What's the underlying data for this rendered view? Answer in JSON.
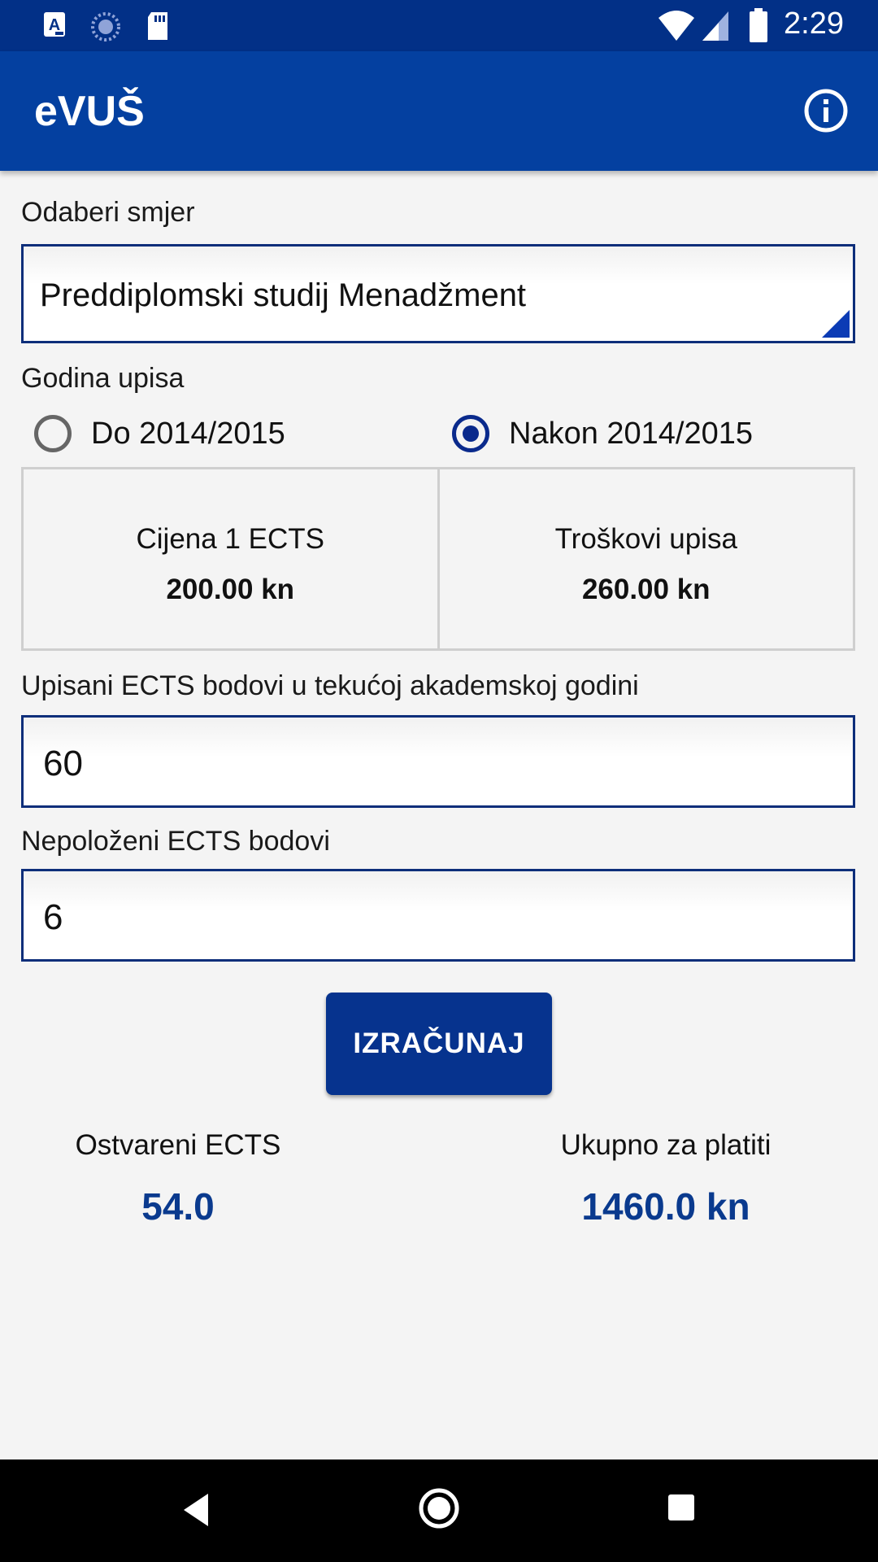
{
  "status_bar": {
    "time": "2:29",
    "icons": [
      "a-badge-icon",
      "sync-icon",
      "sd-card-icon",
      "wifi-icon",
      "signal-icon",
      "battery-icon"
    ]
  },
  "app_bar": {
    "title": "eVUŠ",
    "info_icon": "info-icon"
  },
  "form": {
    "program_label": "Odaberi smjer",
    "program_value": "Preddiplomski studij Menadžment",
    "year_label": "Godina upisa",
    "year_options": [
      {
        "label": "Do 2014/2015",
        "selected": false
      },
      {
        "label": "Nakon 2014/2015",
        "selected": true
      }
    ],
    "price_table": {
      "ects_price_label": "Cijena 1 ECTS",
      "ects_price_value": "200.00 kn",
      "enrollment_cost_label": "Troškovi upisa",
      "enrollment_cost_value": "260.00 kn"
    },
    "enrolled_ects_label": "Upisani ECTS bodovi u tekućoj akademskoj godini",
    "enrolled_ects_value": "60",
    "failed_ects_label": "Nepoloženi ECTS bodovi",
    "failed_ects_value": "6",
    "calculate_button": "IZRAČUNAJ"
  },
  "results": {
    "achieved_label": "Ostvareni ECTS",
    "achieved_value": "54.0",
    "total_label": "Ukupno za platiti",
    "total_value": "1460.0 kn"
  },
  "colors": {
    "status_bar": "#023087",
    "app_bar": "#0440a0",
    "accent": "#0a2a8c",
    "result_text": "#0a3a8e"
  },
  "nav_bar": {
    "icons": [
      "back-icon",
      "home-icon",
      "recents-icon"
    ]
  }
}
